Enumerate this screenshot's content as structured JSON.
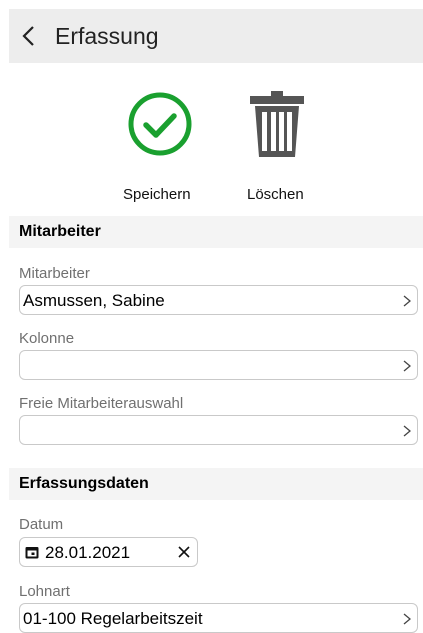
{
  "header": {
    "title": "Erfassung"
  },
  "actions": {
    "save_label": "Speichern",
    "delete_label": "Löschen"
  },
  "sections": {
    "mitarbeiter": "Mitarbeiter",
    "erfassungsdaten": "Erfassungsdaten"
  },
  "fields": {
    "mitarbeiter": {
      "label": "Mitarbeiter",
      "value": "Asmussen, Sabine"
    },
    "kolonne": {
      "label": "Kolonne",
      "value": ""
    },
    "freie_auswahl": {
      "label": "Freie Mitarbeiterauswahl",
      "value": ""
    },
    "datum": {
      "label": "Datum",
      "value": "28.01.2021"
    },
    "lohnart": {
      "label": "Lohnart",
      "value": "01-100 Regelarbeitszeit"
    }
  },
  "colors": {
    "save_green": "#1aa02f",
    "trash_gray": "#555555",
    "header_bg": "#ededed"
  },
  "icons": [
    "back-arrow-icon",
    "checkmark-circle-icon",
    "trash-icon",
    "chevron-right-icon",
    "calendar-icon",
    "clear-icon"
  ]
}
